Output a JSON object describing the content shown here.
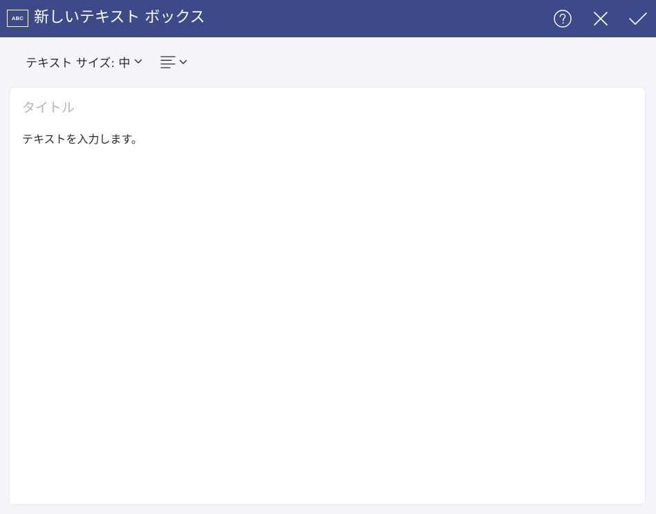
{
  "window": {
    "icon_label": "ABC",
    "title": "新しいテキスト ボックス",
    "icons": {
      "help": "help-circle-icon",
      "close": "close-icon",
      "confirm": "checkmark-icon"
    },
    "colors": {
      "titlebar": "#3d4a8a",
      "background": "#f4f5f9"
    }
  },
  "toolbar": {
    "text_size_label": "テキスト サイズ: 中",
    "text_size_icon": "chevron-down-icon",
    "alignment_icon": "align-left-icon"
  },
  "editor": {
    "title_placeholder": "タイトル",
    "title_value": "",
    "body_text": "テキストを入力します。"
  }
}
